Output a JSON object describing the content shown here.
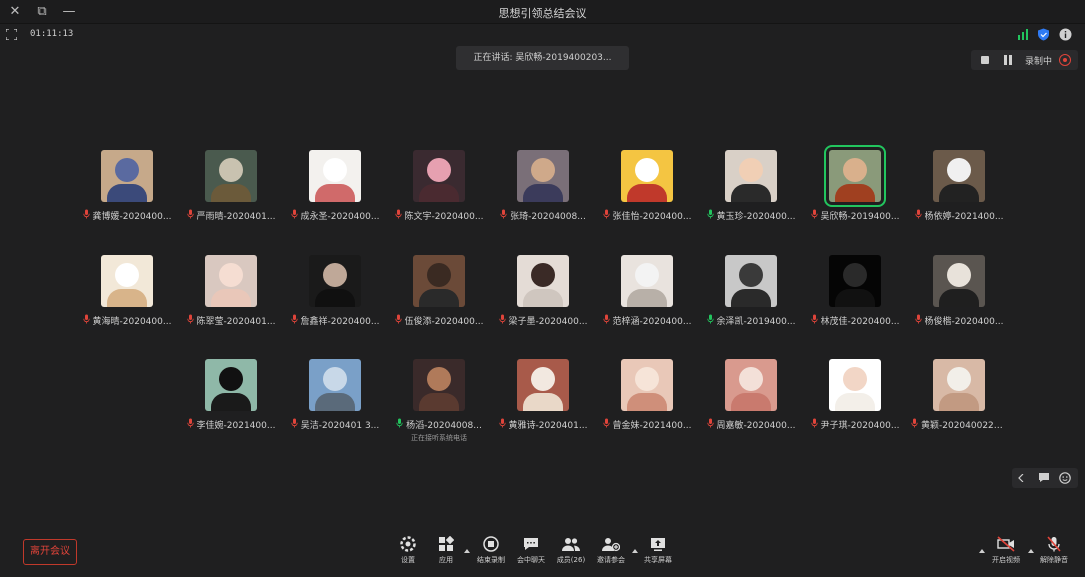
{
  "window": {
    "title": "思想引领总结会议",
    "buttons": {
      "close": "✕",
      "restore": "⧉",
      "minimize": "—"
    }
  },
  "meeting": {
    "timer": "01:11:13",
    "speaking_banner": "正在讲话: 吴欣畅-2019400203..."
  },
  "recording": {
    "label": "录制中"
  },
  "participants": [
    {
      "name": "杨依婷-2021400...",
      "mic": "muted",
      "avatar_bg": "#6b5a4a",
      "face": "#f0f0f0",
      "body": "#222222"
    },
    {
      "name": "吴欣畅-2019400...",
      "mic": "muted",
      "avatar_bg": "#8a9a7a",
      "face": "#d9b08c",
      "body": "#a04020",
      "active": true
    },
    {
      "name": "黄玉珍-2020400...",
      "mic": "active",
      "avatar_bg": "#d9d0c7",
      "face": "#f1cfb5",
      "body": "#2a2a2a"
    },
    {
      "name": "张佳怡-2020400...",
      "mic": "muted",
      "avatar_bg": "#f4c542",
      "face": "#ffffff",
      "body": "#c0392b"
    },
    {
      "name": "张琦-20204008...",
      "mic": "muted",
      "avatar_bg": "#7a6f78",
      "face": "#cfa98a",
      "body": "#3b3b5b"
    },
    {
      "name": "陈文宇-2020400...",
      "mic": "muted",
      "avatar_bg": "#3a2a30",
      "face": "#e6a0b0",
      "body": "#4a2a30"
    },
    {
      "name": "成永圣-2020400...",
      "mic": "muted",
      "avatar_bg": "#f3f1ee",
      "face": "#ffffff",
      "body": "#d06a6a"
    },
    {
      "name": "严雨晴-2020401...",
      "mic": "muted",
      "avatar_bg": "#4a5a4e",
      "face": "#c9c2b0",
      "body": "#6b5a3a"
    },
    {
      "name": "龚博媛-2020400...",
      "mic": "muted",
      "avatar_bg": "#c6a98a",
      "face": "#5a6aa0",
      "body": "#3b4a7a"
    },
    {
      "name": "杨俊楷-2020400...",
      "mic": "muted",
      "avatar_bg": "#5a5550",
      "face": "#e8e2da",
      "body": "#1f1f1f"
    },
    {
      "name": "林茂佳-2020400...",
      "mic": "muted",
      "avatar_bg": "#050505",
      "face": "#2a2a2a",
      "body": "#111111"
    },
    {
      "name": "余泽凯-2019400...",
      "mic": "active",
      "avatar_bg": "#c8c8c8",
      "face": "#3a3a3a",
      "body": "#2a2a2a"
    },
    {
      "name": "范梓涵-2020400...",
      "mic": "muted",
      "avatar_bg": "#e9e3de",
      "face": "#f3f3f3",
      "body": "#b8b0a8"
    },
    {
      "name": "梁子墨-2020400...",
      "mic": "muted",
      "avatar_bg": "#e4dcd6",
      "face": "#3a2a26",
      "body": "#cfc6bf"
    },
    {
      "name": "伍俊添-2020400...",
      "mic": "muted",
      "avatar_bg": "#6b4a38",
      "face": "#3a2a22",
      "body": "#2a2a2a"
    },
    {
      "name": "詹鑫祥-2020400...",
      "mic": "muted",
      "avatar_bg": "#1a1a1a",
      "face": "#bfa898",
      "body": "#101010"
    },
    {
      "name": "陈翠莹-2020401...",
      "mic": "muted",
      "avatar_bg": "#d9c8c0",
      "face": "#f5ddd2",
      "body": "#e9c7b9"
    },
    {
      "name": "黄海晴-2020400...",
      "mic": "muted",
      "avatar_bg": "#f2e8d8",
      "face": "#ffffff",
      "body": "#d8b48a"
    },
    {
      "name": "黄颖-2020400225...",
      "mic": "muted",
      "avatar_bg": "#d8b9a6",
      "face": "#f2efe9",
      "body": "#c29a82"
    },
    {
      "name": "尹子琪-2020400...",
      "mic": "muted",
      "avatar_bg": "#ffffff",
      "face": "#f2d6c6",
      "body": "#f3efe9"
    },
    {
      "name": "周嘉敏-2020400...",
      "mic": "muted",
      "avatar_bg": "#d99a8e",
      "face": "#f3e0d8",
      "body": "#c97a6e"
    },
    {
      "name": "曾金妹-2021400...",
      "mic": "muted",
      "avatar_bg": "#e9c8b8",
      "face": "#f6e4d8",
      "body": "#cf8f7a"
    },
    {
      "name": "黄雅诗-2020401...",
      "mic": "muted",
      "avatar_bg": "#a85a4a",
      "face": "#f2e8e0",
      "body": "#e9d8c8"
    },
    {
      "name": "杨滔-20204008...",
      "mic": "active",
      "avatar_bg": "#3a2a2a",
      "face": "#b07a5a",
      "body": "#5a3a30",
      "sub": "正在接听系统电话"
    },
    {
      "name": "吴洁-2020401 3...",
      "mic": "muted",
      "avatar_bg": "#7aa0c8",
      "face": "#c8d8e8",
      "body": "#5a6a7a"
    },
    {
      "name": "李佳婉-2021400...",
      "mic": "muted",
      "avatar_bg": "#8fb8a8",
      "face": "#111111",
      "body": "#1a1a1a"
    }
  ],
  "toolbar": {
    "leave": "离开会议",
    "settings": "设置",
    "apps": "应用",
    "end_recording": "结束录制",
    "chat": "会中聊天",
    "members": "成员(26)",
    "invite": "邀请参会",
    "share": "共享屏幕",
    "video": "开启视频",
    "audio": "解除静音"
  },
  "colors": {
    "background": "#1f1f20",
    "active_speaker": "#22c55e",
    "leave": "#e0443a",
    "muted_mic": "#e0443a"
  }
}
